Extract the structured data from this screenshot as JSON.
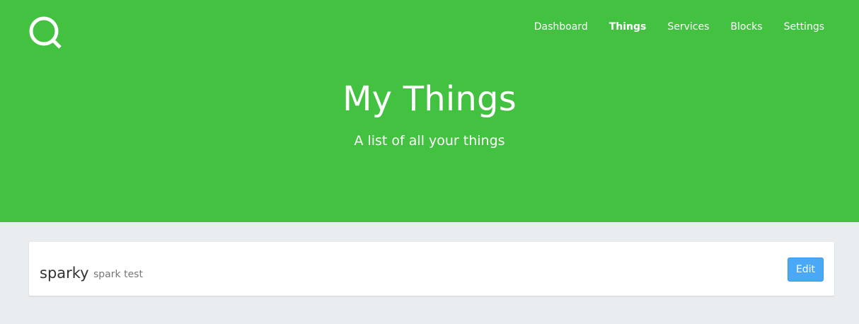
{
  "nav": {
    "logo_icon": "search-icon",
    "items": [
      {
        "label": "Dashboard",
        "active": false
      },
      {
        "label": "Things",
        "active": true
      },
      {
        "label": "Services",
        "active": false
      },
      {
        "label": "Blocks",
        "active": false
      },
      {
        "label": "Settings",
        "active": false
      }
    ]
  },
  "hero": {
    "title": "My Things",
    "subtitle": "A list of all your things",
    "background_color": "#43c141"
  },
  "things": [
    {
      "name": "sparky",
      "description": "spark test",
      "edit_label": "Edit"
    }
  ],
  "colors": {
    "page_background": "#e9edf0",
    "accent_button": "#4aa8f4"
  }
}
